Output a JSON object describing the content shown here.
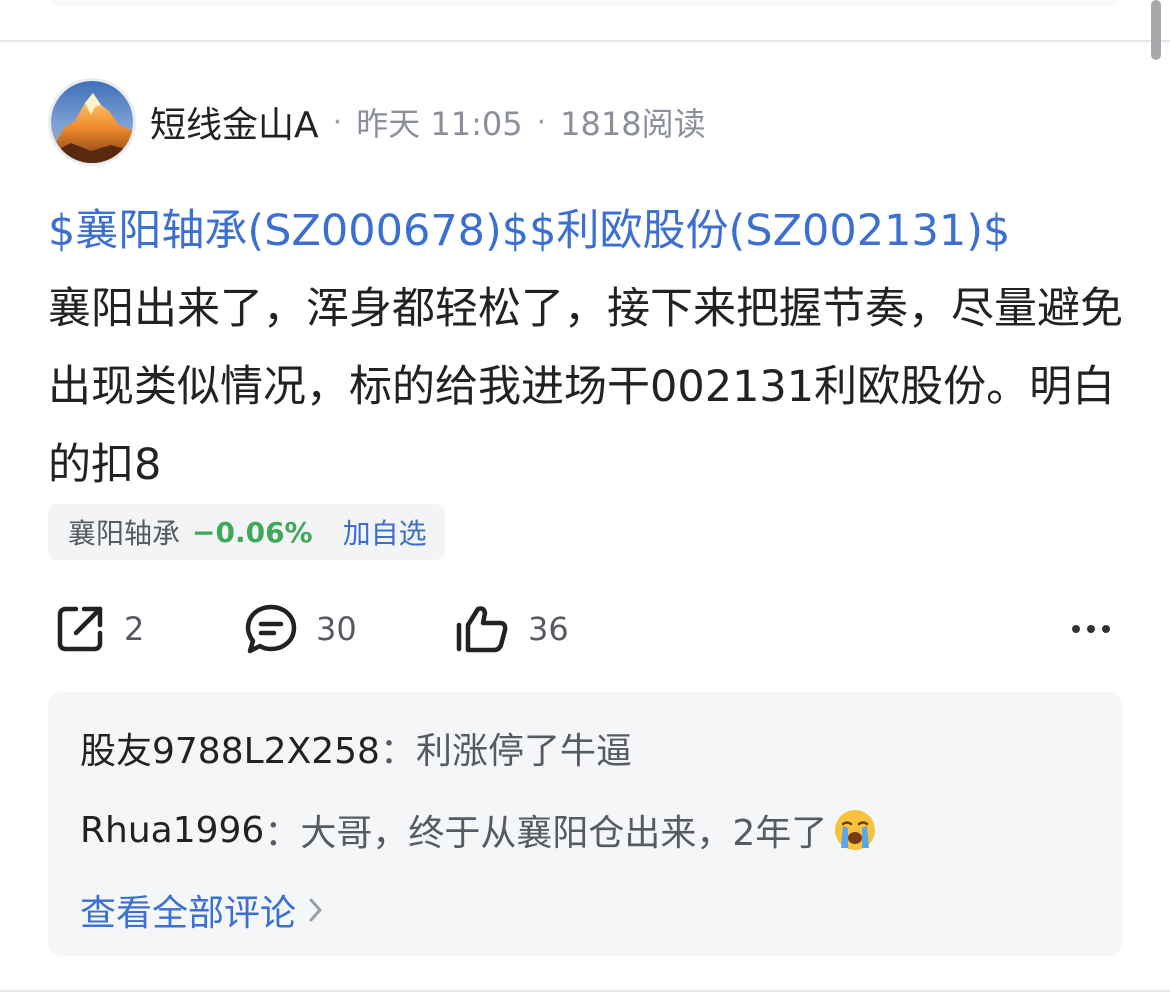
{
  "post": {
    "author": "短线金山A",
    "time": "昨天 11:05",
    "reads": "1818阅读",
    "meta_separator": "·",
    "content": {
      "stock_link_1": "$襄阳轴承(SZ000678)$",
      "stock_link_2": "$利欧股份(SZ002131)$",
      "body": "襄阳出来了，浑身都轻松了，接下来把握节奏，尽量避免出现类似情况，标的给我进场干002131利欧股份。明白的扣8"
    },
    "stock_chip": {
      "name": "襄阳轴承",
      "change": "−0.06%",
      "add_label": "加自选",
      "change_color": "#3fa85a"
    },
    "actions": {
      "share_count": "2",
      "comment_count": "30",
      "like_count": "36"
    },
    "comments": [
      {
        "user": "股友9788L2X258",
        "sep": "：",
        "text": "利涨停了牛逼"
      },
      {
        "user": "Rhua1996",
        "sep": "：",
        "text": "大哥，终于从襄阳仓出来，2年了",
        "emoji": "crying-face"
      }
    ],
    "view_all_label": "查看全部评论"
  },
  "colors": {
    "link": "#3b6fd1",
    "text": "#222222",
    "muted": "#8a8f99",
    "panel": "#f5f6f8"
  }
}
